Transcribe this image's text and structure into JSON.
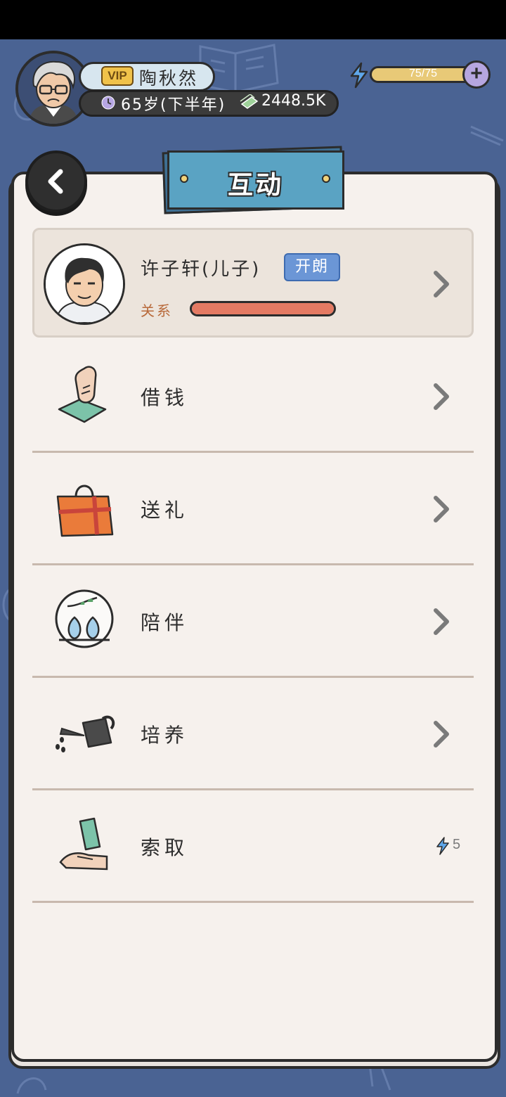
{
  "player": {
    "vip_label": "VIP",
    "name": "陶秋然",
    "age": "65岁(下半年)",
    "money": "2448.5K",
    "energy": "75/75",
    "energy_fraction": 1.0
  },
  "header": {
    "title": "互动"
  },
  "child": {
    "name": "许子轩(儿子)",
    "trait": "开朗",
    "relation_label": "关系",
    "relation_level": 1.0
  },
  "actions": [
    {
      "label": "借钱",
      "icon": "borrow-money-icon"
    },
    {
      "label": "送礼",
      "icon": "gift-bag-icon"
    },
    {
      "label": "陪伴",
      "icon": "birds-companionship-icon"
    },
    {
      "label": "培养",
      "icon": "watering-can-icon"
    },
    {
      "label": "索取",
      "icon": "receive-money-icon",
      "cost": "5"
    }
  ],
  "colors": {
    "background": "#4a6393",
    "panel": "#f6f1ed",
    "title_card": "#5aa3c3",
    "trait_badge": "#6b96d6",
    "relation_fill": "#e47a63",
    "energy_bar": "#e8c977"
  }
}
